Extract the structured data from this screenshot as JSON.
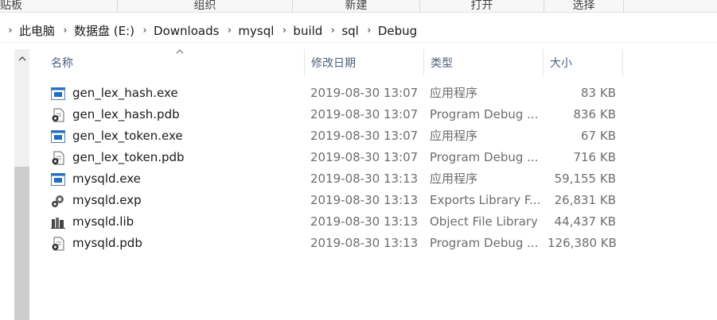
{
  "ribbon": {
    "groups": [
      "剪贴板",
      "组织",
      "新建",
      "打开",
      "选择"
    ]
  },
  "address": {
    "crumbs": [
      "此电脑",
      "数据盘 (E:)",
      "Downloads",
      "mysql",
      "build",
      "sql",
      "Debug"
    ]
  },
  "columns": {
    "name": "名称",
    "date": "修改日期",
    "type": "类型",
    "size": "大小"
  },
  "files": [
    {
      "name": "gen_lex_hash.exe",
      "date": "2019-08-30 13:07",
      "type": "应用程序",
      "size": "83 KB",
      "icon": "exe-icon"
    },
    {
      "name": "gen_lex_hash.pdb",
      "date": "2019-08-30 13:07",
      "type": "Program Debug ...",
      "size": "836 KB",
      "icon": "pdb-icon"
    },
    {
      "name": "gen_lex_token.exe",
      "date": "2019-08-30 13:07",
      "type": "应用程序",
      "size": "67 KB",
      "icon": "exe-icon"
    },
    {
      "name": "gen_lex_token.pdb",
      "date": "2019-08-30 13:07",
      "type": "Program Debug ...",
      "size": "716 KB",
      "icon": "pdb-icon"
    },
    {
      "name": "mysqld.exe",
      "date": "2019-08-30 13:13",
      "type": "应用程序",
      "size": "59,155 KB",
      "icon": "exe-icon"
    },
    {
      "name": "mysqld.exp",
      "date": "2019-08-30 13:13",
      "type": "Exports Library F...",
      "size": "26,831 KB",
      "icon": "exp-icon"
    },
    {
      "name": "mysqld.lib",
      "date": "2019-08-30 13:13",
      "type": "Object File Library",
      "size": "44,437 KB",
      "icon": "lib-icon"
    },
    {
      "name": "mysqld.pdb",
      "date": "2019-08-30 13:13",
      "type": "Program Debug ...",
      "size": "126,380 KB",
      "icon": "pdb-icon"
    }
  ]
}
